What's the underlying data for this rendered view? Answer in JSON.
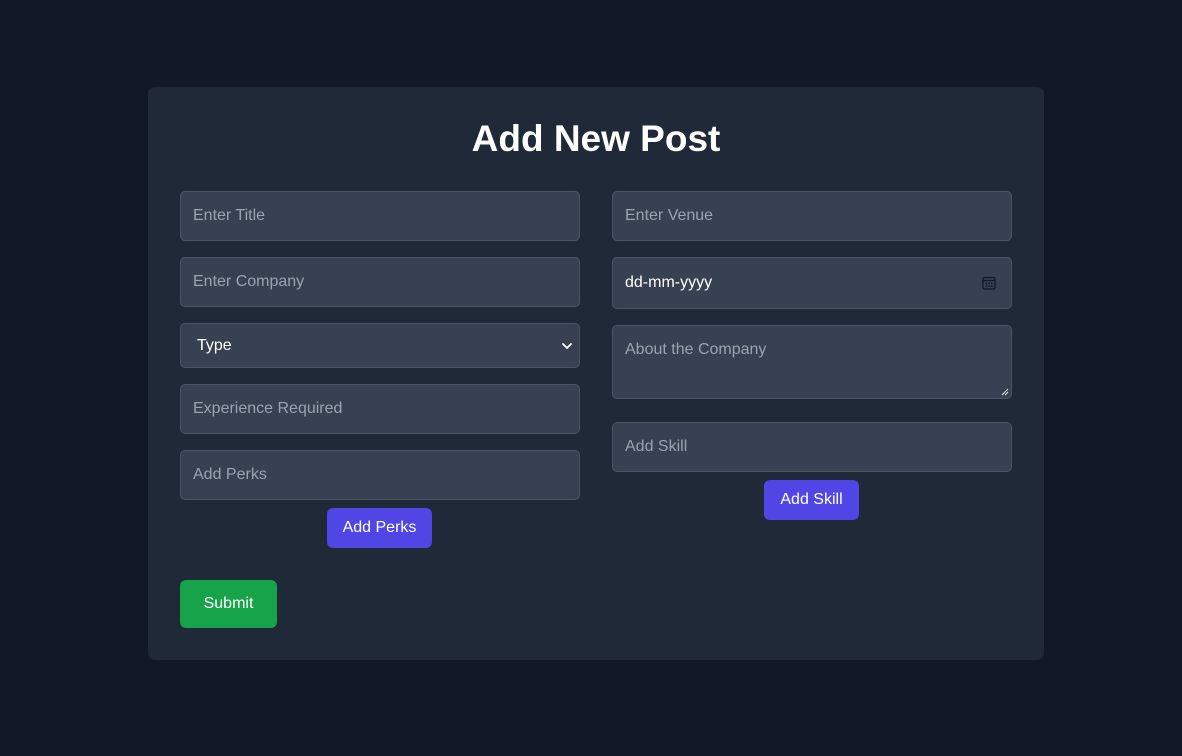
{
  "form": {
    "title": "Add New Post",
    "title_placeholder": "Enter Title",
    "company_placeholder": "Enter Company",
    "type_selected": "Type",
    "experience_placeholder": "Experience Required",
    "perks_placeholder": "Add Perks",
    "add_perks_label": "Add Perks",
    "venue_placeholder": "Enter Venue",
    "date_value": "dd-mm-yyyy",
    "about_placeholder": "About the Company",
    "skill_placeholder": "Add Skill",
    "add_skill_label": "Add Skill",
    "submit_label": "Submit"
  },
  "icons": {
    "type_select": "chevron-down-icon",
    "date_picker": "calendar-icon",
    "textarea_resize": "resize-handle-icon"
  },
  "colors": {
    "page_background": "#111827",
    "card_background": "#1f2937",
    "input_background": "#374151",
    "accent_indigo": "#4f46e5",
    "submit_green": "#16a34a"
  }
}
